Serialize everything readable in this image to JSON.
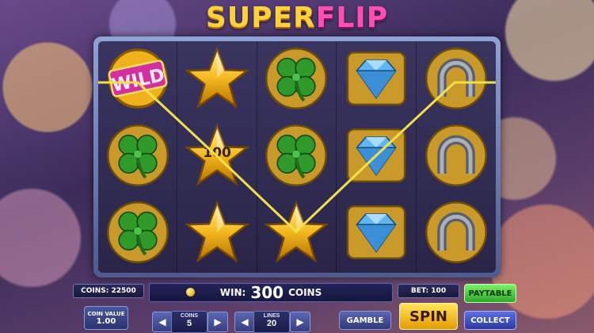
{
  "logo": {
    "part1": "SUPER",
    "part2": "FLIP"
  },
  "reels": [
    [
      "wild",
      "star",
      "clover",
      "diamond",
      "horseshoe"
    ],
    [
      "clover",
      "star",
      "clover",
      "diamond",
      "horseshoe"
    ],
    [
      "clover",
      "star",
      "star",
      "diamond",
      "horseshoe"
    ]
  ],
  "wild_text": "WILD",
  "multiplier_label": "100",
  "status": {
    "coins_label": "COINS: 22500",
    "win_label": "WIN:",
    "win_amount": "300",
    "win_unit": "COINS",
    "bet_label": "BET: 100"
  },
  "controls": {
    "coin_value_label": "COIN VALUE",
    "coin_value": "1.00",
    "coins_label": "COINS",
    "coins_value": "5",
    "lines_label": "LINES",
    "lines_value": "20",
    "gamble": "GAMBLE",
    "spin": "SPIN",
    "paytable": "PAYTABLE",
    "collect": "COLLECT"
  },
  "colors": {
    "payline": "#f2e04a",
    "accent_gold": "#ffd23a",
    "accent_pink": "#ff4fb4",
    "spin_bg": "#f7c21e",
    "paytable_bg": "#46c83a",
    "collect_bg": "#3b4fb8"
  }
}
